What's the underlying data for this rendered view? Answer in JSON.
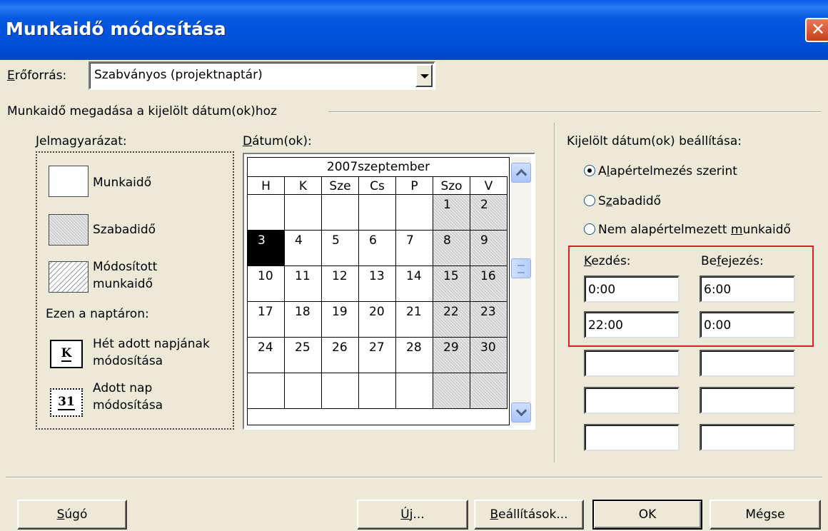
{
  "window": {
    "title": "Munkaidő módosítása",
    "close_label": "✕"
  },
  "resource": {
    "label_u": "E",
    "label_rest": "rőforrás:",
    "value": "Szabványos (projektnaptár)"
  },
  "group": {
    "title": "Munkaidő megadása a kijelölt dátum(ok)hoz"
  },
  "legend": {
    "title": "Jelmagyarázat:",
    "work": "Munkaidő",
    "nonwork": "Szabadidő",
    "modified_1": "Módosított",
    "modified_2": "munkaidő",
    "subtitle": "Ezen a naptáron:",
    "weekday_icon": "K",
    "weekday_1": "Hét adott napjának",
    "weekday_2": "módosítása",
    "day_icon": "31",
    "day_1": "Adott nap",
    "day_2": "módosítása"
  },
  "calendar": {
    "label_u": "D",
    "label_rest": "átum(ok):",
    "month_title": "2007szeptember",
    "weekdays": [
      "H",
      "K",
      "Sze",
      "Cs",
      "P",
      "Szo",
      "V"
    ],
    "weeks": [
      [
        "",
        "",
        "",
        "",
        "",
        "1",
        "2"
      ],
      [
        "3",
        "4",
        "5",
        "6",
        "7",
        "8",
        "9"
      ],
      [
        "10",
        "11",
        "12",
        "13",
        "14",
        "15",
        "16"
      ],
      [
        "17",
        "18",
        "19",
        "20",
        "21",
        "22",
        "23"
      ],
      [
        "24",
        "25",
        "26",
        "27",
        "28",
        "29",
        "30"
      ],
      [
        "",
        "",
        "",
        "",
        "",
        "",
        ""
      ]
    ],
    "selected_day": "3"
  },
  "settings": {
    "label": "Kijelölt dátum(ok) beállítása:",
    "options": [
      {
        "pre": "A",
        "u": "l",
        "post": "apértelmezés szerint",
        "checked": true
      },
      {
        "pre": "S",
        "u": "z",
        "post": "abadidő",
        "checked": false
      },
      {
        "pre": "Nem alapértelmezett ",
        "u": "m",
        "post": "unkaidő",
        "checked": false
      }
    ],
    "start_label_u": "K",
    "start_label_rest": "ezdés:",
    "end_label_pre": "Be",
    "end_label_u": "f",
    "end_label_post": "ejezés:",
    "rows": [
      {
        "start": "0:00",
        "end": "6:00"
      },
      {
        "start": "22:00",
        "end": "0:00"
      },
      {
        "start": "",
        "end": ""
      },
      {
        "start": "",
        "end": ""
      },
      {
        "start": "",
        "end": ""
      }
    ]
  },
  "buttons": {
    "help_u": "S",
    "help_rest": "úgó",
    "new_u": "Ú",
    "new_rest": "j...",
    "options_u": "B",
    "options_rest": "eállítások...",
    "ok": "OK",
    "cancel": "Mégse"
  }
}
